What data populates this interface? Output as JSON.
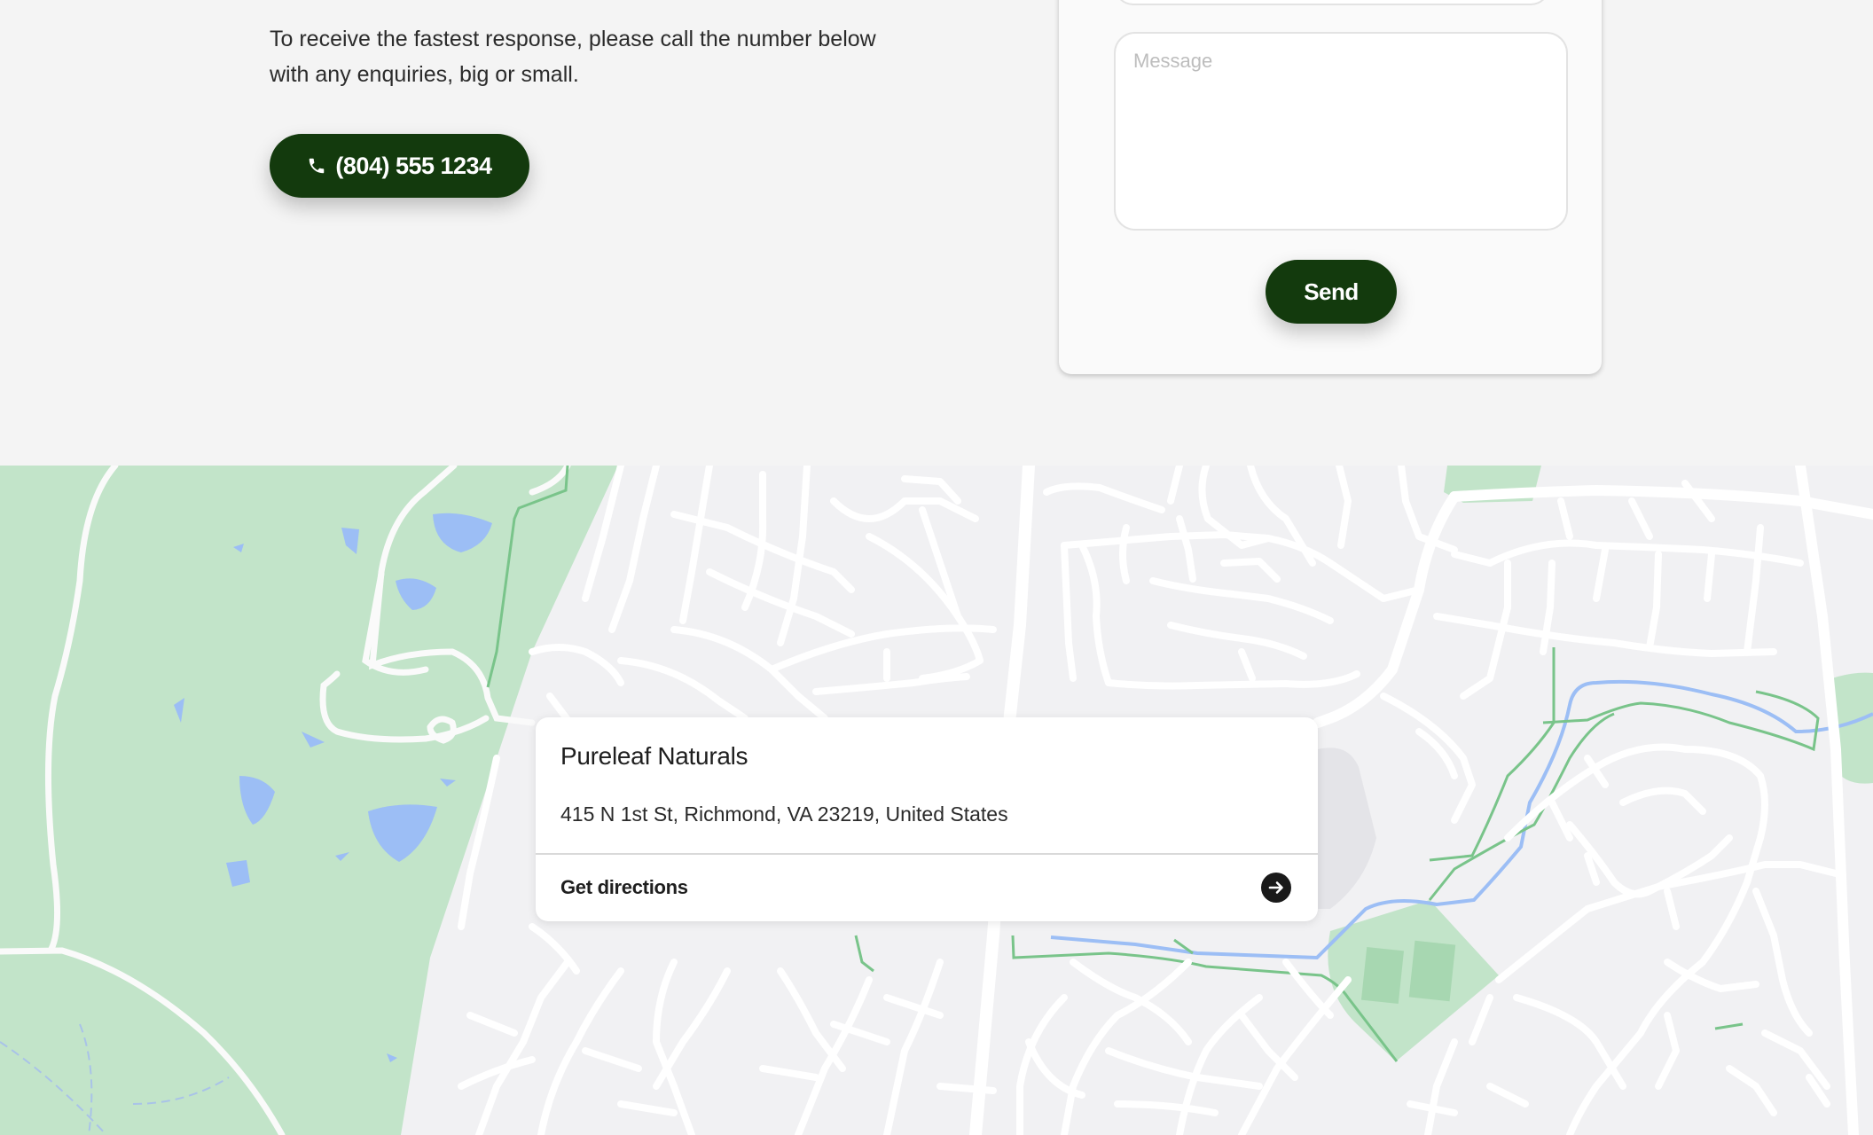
{
  "contact": {
    "intro_text": "To receive the fastest response, please call the number below with any enquiries, big or small.",
    "phone_label": "(804) 555 1234",
    "phone_icon": "phone-icon"
  },
  "form": {
    "message_placeholder": "Message",
    "send_label": "Send"
  },
  "map": {
    "place_name": "Pureleaf Naturals",
    "address": "415 N 1st St, Richmond, VA 23219, United States",
    "directions_label": "Get directions",
    "directions_icon": "arrow-right-circle-icon"
  },
  "colors": {
    "brand_dark_green": "#133a0d",
    "park_green": "#c2e4c9",
    "water_blue": "#9cbef5",
    "map_background": "#f1f1f3"
  }
}
